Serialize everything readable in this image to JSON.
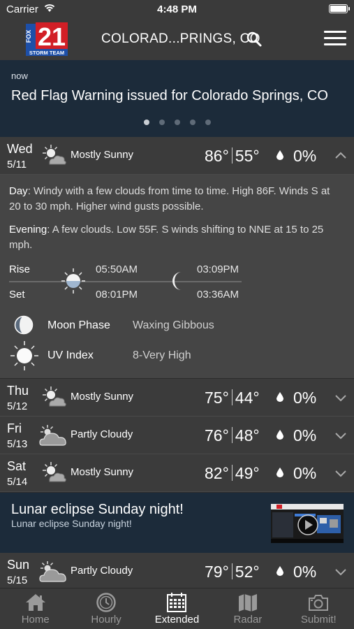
{
  "status_bar": {
    "carrier": "Carrier",
    "time": "4:48 PM"
  },
  "header": {
    "logo_number": "21",
    "logo_brand": "FOX",
    "logo_sub": "STORM TEAM",
    "location": "COLORAD...PRINGS, CO"
  },
  "alert": {
    "when": "now",
    "message": "Red Flag Warning issued for Colorado Springs, CO",
    "dots": 5,
    "active_dot": 0
  },
  "expanded_day": {
    "day": "Wed",
    "date": "5/11",
    "condition": "Mostly Sunny",
    "icon": "mostly-sunny-icon",
    "high": "86°",
    "low": "55°",
    "precip": "0%",
    "day_label": "Day",
    "day_text": ": Windy with a few clouds from time to time. High 86F. Winds S at 20 to 30 mph.  Higher wind gusts possible.",
    "evening_label": "Evening",
    "evening_text": ": A few clouds. Low 55F. S winds shifting to NNE at 15 to 25 mph.",
    "rise_label": "Rise",
    "set_label": "Set",
    "sunrise": "05:50AM",
    "sunset": "08:01PM",
    "moonrise": "03:09PM",
    "moonset": "03:36AM",
    "moon_phase_label": "Moon Phase",
    "moon_phase": "Waxing Gibbous",
    "uv_label": "UV Index",
    "uv": "8-Very High"
  },
  "days": [
    {
      "day": "Thu",
      "date": "5/12",
      "condition": "Mostly Sunny",
      "icon": "mostly-sunny-icon",
      "high": "75°",
      "low": "44°",
      "precip": "0%"
    },
    {
      "day": "Fri",
      "date": "5/13",
      "condition": "Partly Cloudy",
      "icon": "partly-cloudy-icon",
      "high": "76°",
      "low": "48°",
      "precip": "0%"
    },
    {
      "day": "Sat",
      "date": "5/14",
      "condition": "Mostly Sunny",
      "icon": "mostly-sunny-icon",
      "high": "82°",
      "low": "49°",
      "precip": "0%"
    },
    {
      "day": "Sun",
      "date": "5/15",
      "condition": "Partly Cloudy",
      "icon": "partly-cloudy-icon",
      "high": "79°",
      "low": "52°",
      "precip": "0%"
    }
  ],
  "promo": {
    "title": "Lunar eclipse Sunday night!",
    "subtitle": "Lunar eclipse Sunday night!"
  },
  "tabs": [
    {
      "label": "Home",
      "icon": "home-icon"
    },
    {
      "label": "Hourly",
      "icon": "clock-icon"
    },
    {
      "label": "Extended",
      "icon": "calendar-icon",
      "active": true
    },
    {
      "label": "Radar",
      "icon": "map-icon"
    },
    {
      "label": "Submit!",
      "icon": "camera-icon"
    }
  ],
  "colors": {
    "background": "#2c2c2c",
    "row": "#3b3b3b",
    "expanded": "#454545",
    "banner": "#1c2b3a",
    "logo_blue": "#1d4fa8",
    "logo_red": "#d21f26"
  }
}
